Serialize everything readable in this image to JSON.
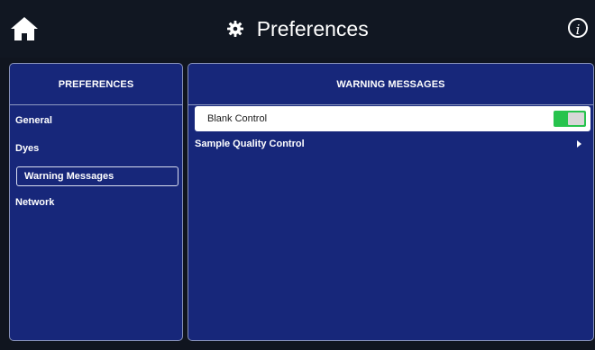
{
  "header": {
    "title": "Preferences",
    "home_icon": "home-icon",
    "settings_icon": "gear-icon",
    "info_icon": "info-icon",
    "info_glyph": "i"
  },
  "left_panel": {
    "header": "PREFERENCES",
    "items": [
      {
        "label": "General",
        "selected": false
      },
      {
        "label": "Dyes",
        "selected": false
      },
      {
        "label": "Warning Messages",
        "selected": true
      },
      {
        "label": "Network",
        "selected": false
      }
    ]
  },
  "right_panel": {
    "header": "WARNING MESSAGES",
    "rows": [
      {
        "label": "Blank Control",
        "type": "toggle",
        "value": true
      },
      {
        "label": "Sample Quality Control",
        "type": "submenu"
      }
    ]
  },
  "colors": {
    "panel": "#17277a",
    "topbar": "#111722",
    "toggle_on": "#27c34d"
  }
}
